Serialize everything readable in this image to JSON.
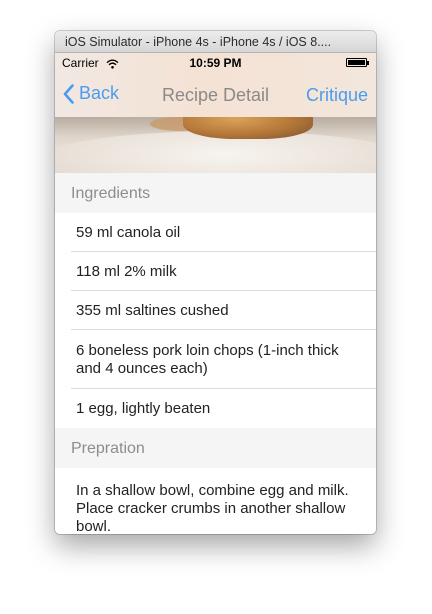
{
  "window": {
    "title": "iOS Simulator - iPhone 4s - iPhone 4s / iOS 8...."
  },
  "status_bar": {
    "carrier": "Carrier",
    "time": "10:59 PM",
    "wifi_icon": "wifi-icon",
    "battery_icon": "battery-icon"
  },
  "nav": {
    "back_label": "Back",
    "title": "Recipe Detail",
    "right_label": "Critique",
    "accent_color": "#4a9cf0"
  },
  "ingredients": {
    "header": "Ingredients",
    "items": [
      "59 ml canola oil",
      "118 ml 2% milk",
      "355 ml saltines cushed",
      "6  boneless pork loin chops (1-inch thick and 4 ounces each)",
      "1  egg, lightly beaten"
    ]
  },
  "preparation": {
    "header": "Prepration",
    "text": "In a shallow bowl, combine egg and milk. Place cracker crumbs in another shallow bowl."
  }
}
